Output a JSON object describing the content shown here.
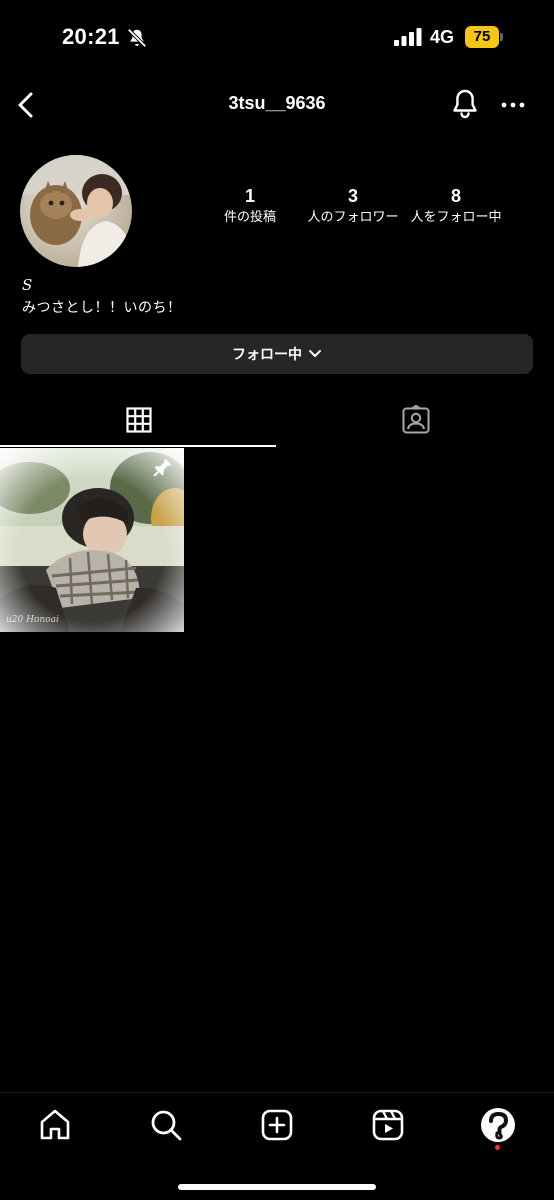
{
  "status_bar": {
    "time": "20:21",
    "network": "4G",
    "battery": "75",
    "battery_color": "#f5c518"
  },
  "header": {
    "username": "3tsu__9636",
    "back_icon": "chevron-left-icon",
    "bell_icon": "bell-icon",
    "more_icon": "more-horizontal-icon"
  },
  "profile": {
    "stats": [
      {
        "value": "1",
        "label": "件の投稿"
      },
      {
        "value": "3",
        "label": "人のフォロワー"
      },
      {
        "value": "8",
        "label": "人をフォロー中"
      }
    ],
    "bio_name": "S",
    "bio_text": "みつさとし！！いのち！"
  },
  "follow_button": {
    "label": "フォロー中"
  },
  "tabs": [
    {
      "name": "posts-grid",
      "icon": "grid-icon",
      "active": true
    },
    {
      "name": "tagged",
      "icon": "tagged-person-icon",
      "active": false
    }
  ],
  "posts": [
    {
      "pinned": true,
      "icon": "pin-icon",
      "watermark": "u20 Honoai"
    }
  ],
  "bottom_nav": [
    {
      "name": "home",
      "icon": "home-icon"
    },
    {
      "name": "search",
      "icon": "search-icon"
    },
    {
      "name": "create",
      "icon": "plus-square-icon"
    },
    {
      "name": "reels",
      "icon": "reels-icon"
    },
    {
      "name": "profile",
      "icon": "profile-avatar-icon",
      "notification_dot": true
    }
  ]
}
